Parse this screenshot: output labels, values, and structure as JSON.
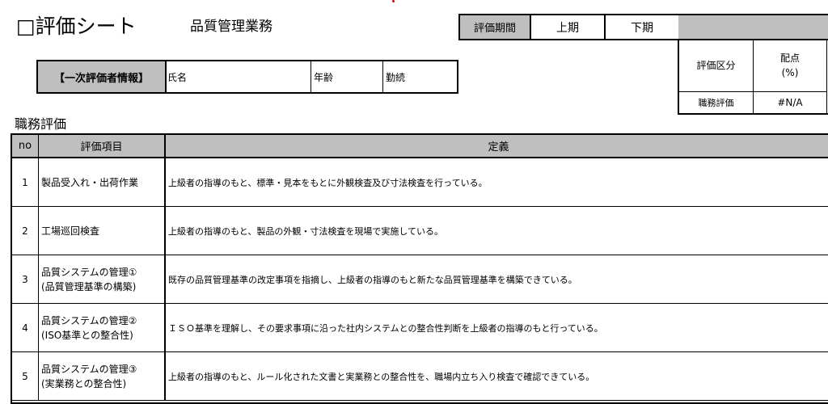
{
  "header": {
    "sheet_title": "□評価シート",
    "department": "品質管理業務"
  },
  "evaluator": {
    "label": "【一次評価者情報】",
    "name_label": "氏名",
    "age_label": "年齢",
    "tenure_label": "勤続"
  },
  "period": {
    "label": "評価期間",
    "first_half": "上期",
    "second_half": "下期"
  },
  "score_table": {
    "category_header": "評価区分",
    "points_header_line1": "配点",
    "points_header_line2": "(%)",
    "row_label": "職務評価",
    "row_value": "#N/A"
  },
  "section": {
    "title": "職務評価"
  },
  "table": {
    "headers": {
      "no": "no",
      "item": "評価項目",
      "definition": "定義"
    },
    "rows": [
      {
        "no": "1",
        "item_line1": "製品受入れ・出荷作業",
        "item_line2": "",
        "definition": "上級者の指導のもと、標準・見本をもとに外観検査及び寸法検査を行っている。"
      },
      {
        "no": "2",
        "item_line1": "工場巡回検査",
        "item_line2": "",
        "definition": "上級者の指導のもと、製品の外観・寸法検査を現場で実施している。"
      },
      {
        "no": "3",
        "item_line1": "品質システムの管理①",
        "item_line2": "(品質管理基準の構築)",
        "definition": "既存の品質管理基準の改定事項を指摘し、上級者の指導のもと新たな品質管理基準を構築できている。"
      },
      {
        "no": "4",
        "item_line1": "品質システムの管理②",
        "item_line2": "(ISO基準との整合性)",
        "definition": "ＩＳＯ基準を理解し、その要求事項に沿った社内システムとの整合性判断を上級者の指導のもと行っている。"
      },
      {
        "no": "5",
        "item_line1": "品質システムの管理③",
        "item_line2": "(実業務との整合性)",
        "definition": "上級者の指導のもと、ルール化された文書と実業務との整合性を、職場内立ち入り検査で確認できている。"
      }
    ]
  }
}
